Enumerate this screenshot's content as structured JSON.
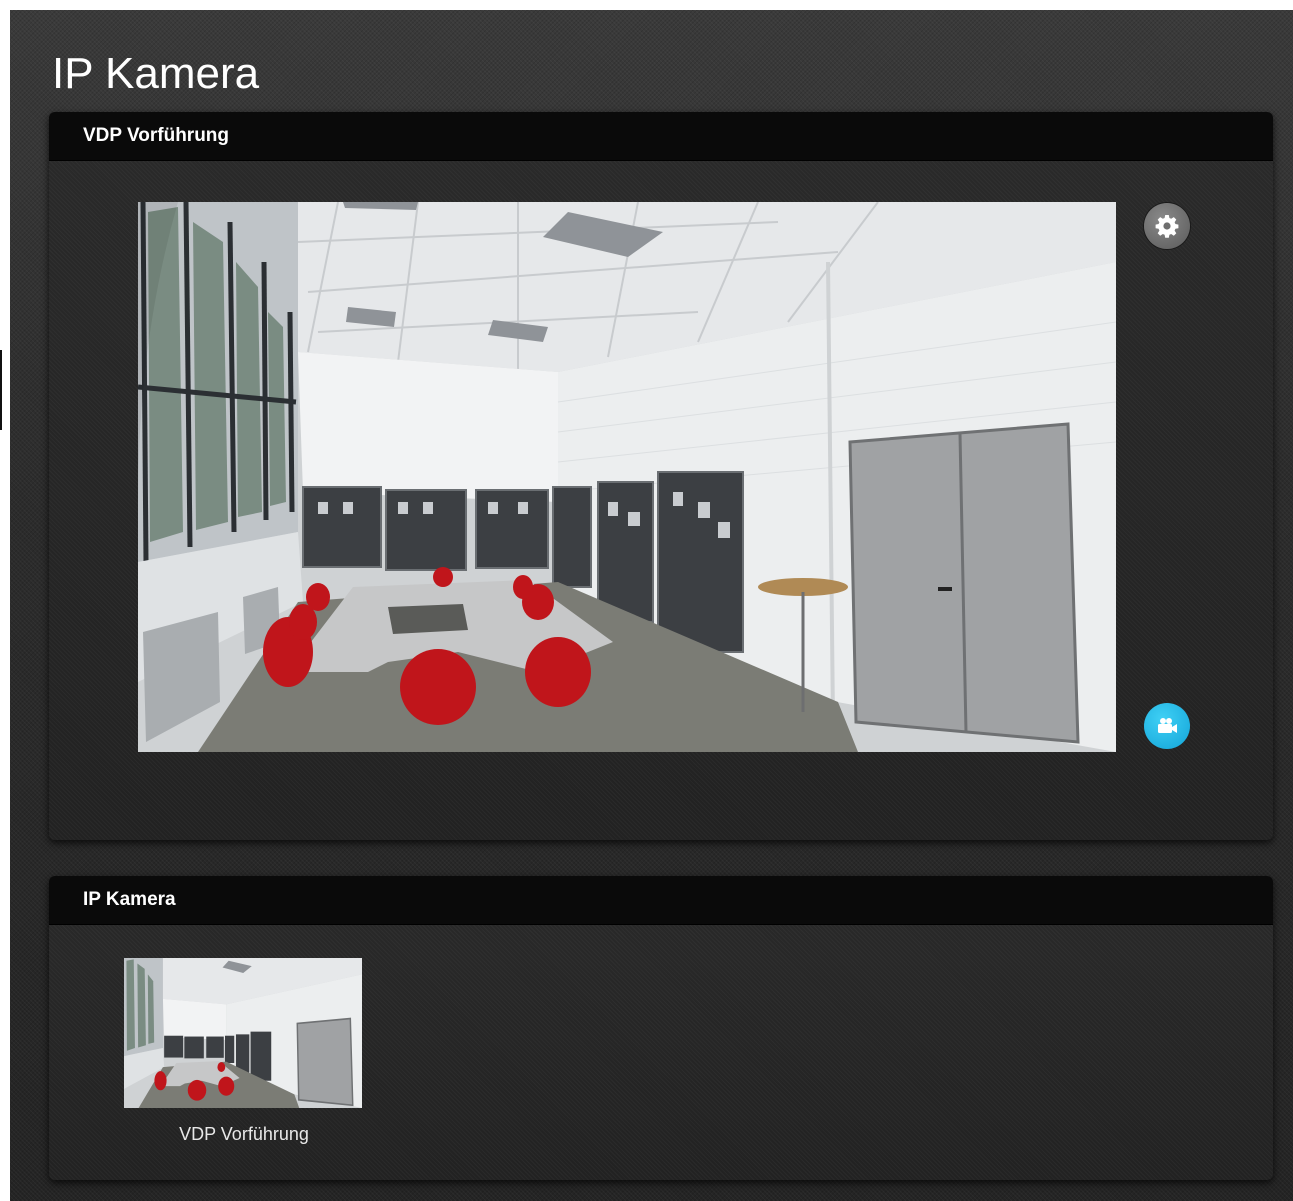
{
  "page": {
    "title": "IP Kamera"
  },
  "main_panel": {
    "header": "VDP Vorführung",
    "settings_icon": "gear-icon",
    "record_icon": "video-camera-icon",
    "record_color": "#1fb4e6"
  },
  "camera_list_panel": {
    "header": "IP Kamera",
    "cameras": [
      {
        "label": "VDP Vorführung"
      }
    ]
  }
}
